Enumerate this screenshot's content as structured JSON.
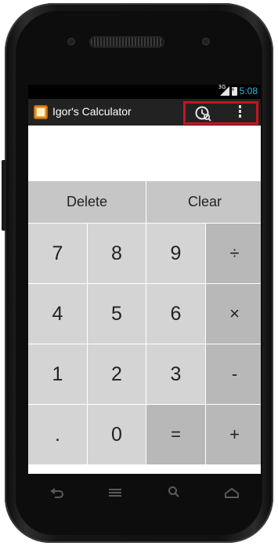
{
  "status_bar": {
    "network_label": "3G",
    "time": "5:08"
  },
  "action_bar": {
    "app_title": "Igor's Calculator"
  },
  "display": {
    "value": ""
  },
  "keypad": {
    "delete_label": "Delete",
    "clear_label": "Clear",
    "rows": [
      [
        "7",
        "8",
        "9",
        "÷"
      ],
      [
        "4",
        "5",
        "6",
        "×"
      ],
      [
        "1",
        "2",
        "3",
        "-"
      ],
      [
        ".",
        "0",
        "=",
        "+"
      ]
    ]
  },
  "colors": {
    "accent": "#33b5e5",
    "highlight_border": "#c8141e",
    "action_bar": "#222222",
    "key": "#d4d4d4",
    "operator_key": "#b8b8b8"
  },
  "icons": [
    "history-icon",
    "overflow-menu-icon",
    "back-icon",
    "home-icon",
    "recent-apps-icon",
    "search-icon"
  ]
}
